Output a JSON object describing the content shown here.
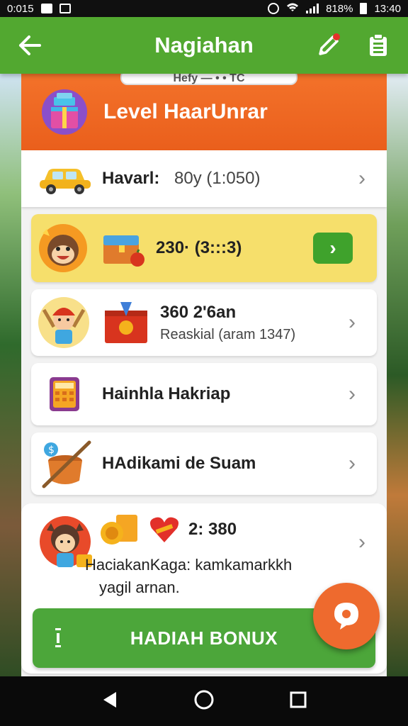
{
  "status_bar": {
    "time_left": "0:015",
    "battery": "818%",
    "time_right": "13:40"
  },
  "app_bar": {
    "title": "Nagiahan"
  },
  "panel": {
    "tab_peek": "Hefy  —  • • TC",
    "level_header": {
      "title": "Level HaarUnrar"
    },
    "rows": [
      {
        "label": "Havarl:",
        "value": "80y (1:050)"
      },
      {
        "text": "230· (3:::3)"
      },
      {
        "title": "360 2'6an",
        "subtitle": "Reaskial (aram 1347)"
      },
      {
        "text": "Hainhla Hakriap"
      },
      {
        "text": "HAdikami de Suam"
      },
      {
        "amount": "2: 380",
        "line1": "HaciakanKaga: kamkamarkkh",
        "line2": "yagil arnan."
      }
    ],
    "bonus_button": {
      "label": "HADIAH BONUX"
    }
  },
  "colors": {
    "app_bar": "#52a830",
    "header": "#ef6a24",
    "highlight_row": "#f6df6b",
    "button_green": "#4ca63a",
    "fab": "#ee6a2e"
  },
  "icons": {
    "back": "arrow-left-icon",
    "edit": "pencil-icon",
    "clipboard": "clipboard-icon",
    "level": "gift-box-icon",
    "car": "car-icon",
    "monkey": "monkey-avatar-icon",
    "chest": "treasure-chest-icon",
    "pirate": "pirate-avatar-icon",
    "medal": "medal-box-icon",
    "calculator": "calculator-icon",
    "drum": "drum-icon",
    "girl": "girl-avatar-icon",
    "coin": "coin-icon",
    "heart": "heart-icon",
    "chat": "chat-icon"
  }
}
